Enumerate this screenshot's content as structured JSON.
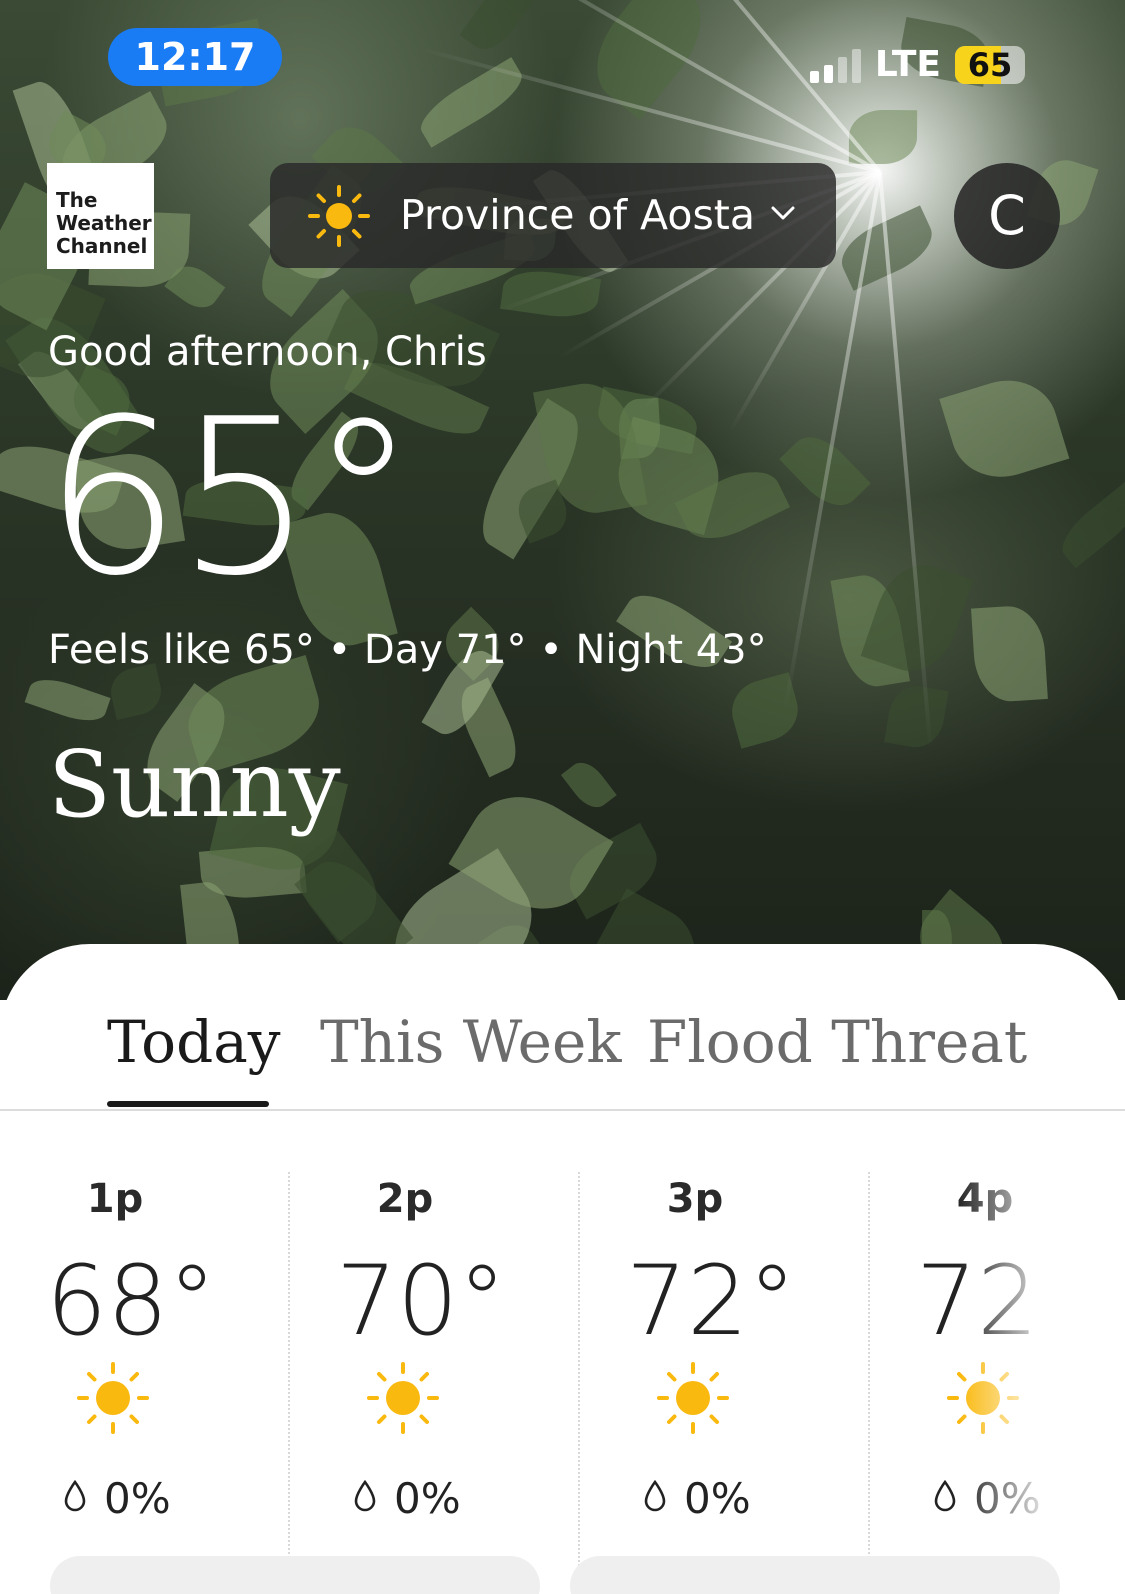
{
  "status_bar": {
    "time": "12:17",
    "network": "LTE",
    "battery": 65,
    "signal_bars": 2
  },
  "header": {
    "logo_lines": [
      "The",
      "Weather",
      "Channel"
    ],
    "location": "Province of Aosta",
    "avatar_initial": "C"
  },
  "current": {
    "greeting": "Good afternoon, Chris",
    "temperature": "65°",
    "details": "Feels like 65° • Day 71° • Night 43°",
    "condition": "Sunny"
  },
  "tabs": [
    {
      "label": "Today",
      "active": true
    },
    {
      "label": "This Week",
      "active": false
    },
    {
      "label": "Flood Threat",
      "active": false
    }
  ],
  "hourly": [
    {
      "time": "1p",
      "temp": "68°",
      "icon": "sun-icon",
      "precip": "0%"
    },
    {
      "time": "2p",
      "temp": "70°",
      "icon": "sun-icon",
      "precip": "0%"
    },
    {
      "time": "3p",
      "temp": "72°",
      "icon": "sun-icon",
      "precip": "0%"
    },
    {
      "time": "4p",
      "temp": "72",
      "icon": "sun-icon",
      "precip": "0%"
    }
  ],
  "colors": {
    "accent": "#1a7cf5",
    "sun": "#f9b90f",
    "battery": "#f7d31c"
  }
}
